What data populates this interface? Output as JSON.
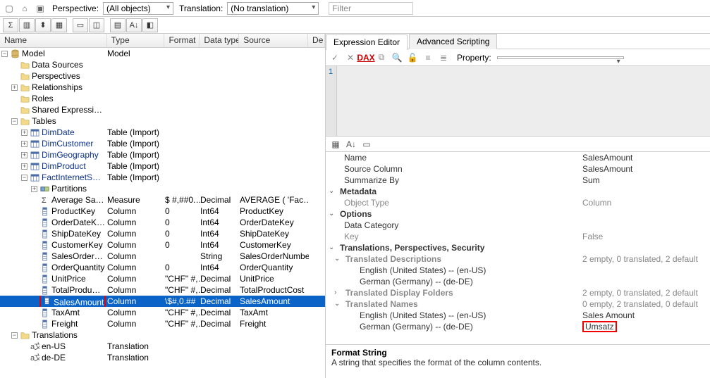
{
  "top": {
    "perspective_label": "Perspective:",
    "perspective_value": "(All objects)",
    "translation_label": "Translation:",
    "translation_value": "(No translation)",
    "filter_placeholder": "Filter"
  },
  "tree_headers": {
    "name": "Name",
    "type": "Type",
    "format": "Format",
    "datatype": "Data type",
    "source": "Source",
    "desc": "De…"
  },
  "tree": {
    "model": "Model",
    "data_sources": "Data Sources",
    "perspectives": "Perspectives",
    "relationships": "Relationships",
    "roles": "Roles",
    "shared_expr": "Shared Expressi…",
    "tables": "Tables",
    "dimdate": "DimDate",
    "dimcustomer": "DimCustomer",
    "dimgeography": "DimGeography",
    "dimproduct": "DimProduct",
    "factinternet": "FactInternetS…",
    "partitions": "Partitions",
    "avg_sales": "Average Sa…",
    "productkey": "ProductKey",
    "orderdatekey": "OrderDateK…",
    "shipdatekey": "ShipDateKey",
    "customerkey": "CustomerKey",
    "salesorder": "SalesOrder…",
    "orderqty": "OrderQuantity",
    "unitprice": "UnitPrice",
    "totalprod": "TotalProdu…",
    "salesamount": "SalesAmount",
    "taxamt": "TaxAmt",
    "freight": "Freight",
    "translations": "Translations",
    "en_us": "en-US",
    "de_de": "de-DE"
  },
  "types": {
    "model": "Model",
    "table_import": "Table (Import)",
    "measure": "Measure",
    "column": "Column",
    "translation": "Translation"
  },
  "formats": {
    "measure_fmt": "$ #,##0.…",
    "zero": "0",
    "chf": "\"CHF\" #,…",
    "sel": "\\$#,0.##",
    "blank": ""
  },
  "datatypes": {
    "decimal": "Decimal",
    "int64": "Int64",
    "string": "String"
  },
  "sources": {
    "avg": "AVERAGE ( 'Fac…",
    "productkey": "ProductKey",
    "orderdatekey": "OrderDateKey",
    "shipdatekey": "ShipDateKey",
    "customerkey": "CustomerKey",
    "salesordernum": "SalesOrderNumber",
    "orderqty": "OrderQuantity",
    "unitprice": "UnitPrice",
    "totalprodcost": "TotalProductCost",
    "salesamount": "SalesAmount",
    "taxamt": "TaxAmt",
    "freight": "Freight"
  },
  "right": {
    "tab1": "Expression Editor",
    "tab2": "Advanced Scripting",
    "dax": "DAX",
    "property_label": "Property:",
    "line_no": "1"
  },
  "props": {
    "name_label": "Name",
    "name_value": "SalesAmount",
    "source_col_label": "Source Column",
    "source_col_value": "SalesAmount",
    "summarize_label": "Summarize By",
    "summarize_value": "Sum",
    "metadata": "Metadata",
    "object_type_label": "Object Type",
    "object_type_value": "Column",
    "options": "Options",
    "data_category_label": "Data Category",
    "key_label": "Key",
    "key_value": "False",
    "tps": "Translations, Perspectives, Security",
    "trans_desc": "Translated Descriptions",
    "trans_desc_v": "2 empty, 0 translated, 2 default",
    "en_us": "English (United States) -- (en-US)",
    "de_de": "German (Germany) -- (de-DE)",
    "trans_folders": "Translated Display Folders",
    "trans_folders_v": "2 empty, 0 translated, 2 default",
    "trans_names": "Translated Names",
    "trans_names_v": "0 empty, 2 translated, 0 default",
    "tn_en_v": "Sales Amount",
    "tn_de_v": "Umsatz"
  },
  "desc": {
    "title": "Format String",
    "body": "A string that specifies the format of the column contents."
  }
}
